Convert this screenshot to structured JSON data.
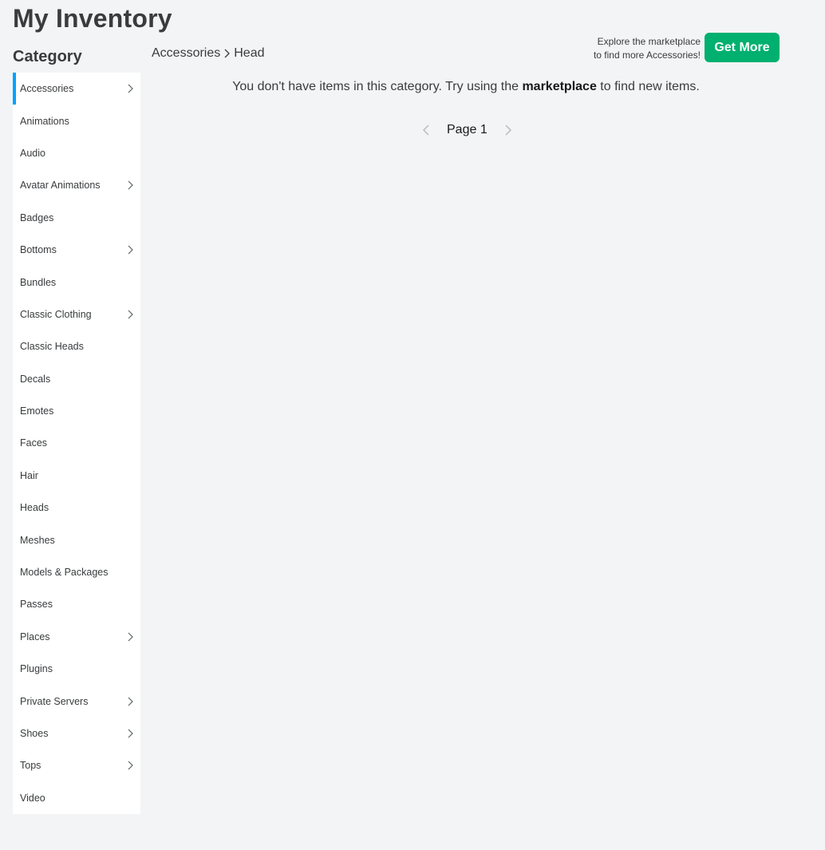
{
  "header": {
    "title": "My Inventory"
  },
  "sidebar": {
    "heading": "Category",
    "items": [
      {
        "label": "Accessories",
        "has_submenu": true,
        "active": true
      },
      {
        "label": "Animations",
        "has_submenu": false
      },
      {
        "label": "Audio",
        "has_submenu": false
      },
      {
        "label": "Avatar Animations",
        "has_submenu": true
      },
      {
        "label": "Badges",
        "has_submenu": false
      },
      {
        "label": "Bottoms",
        "has_submenu": true
      },
      {
        "label": "Bundles",
        "has_submenu": false
      },
      {
        "label": "Classic Clothing",
        "has_submenu": true
      },
      {
        "label": "Classic Heads",
        "has_submenu": false
      },
      {
        "label": "Decals",
        "has_submenu": false
      },
      {
        "label": "Emotes",
        "has_submenu": false
      },
      {
        "label": "Faces",
        "has_submenu": false
      },
      {
        "label": "Hair",
        "has_submenu": false
      },
      {
        "label": "Heads",
        "has_submenu": false
      },
      {
        "label": "Meshes",
        "has_submenu": false
      },
      {
        "label": "Models & Packages",
        "has_submenu": false
      },
      {
        "label": "Passes",
        "has_submenu": false
      },
      {
        "label": "Places",
        "has_submenu": true
      },
      {
        "label": "Plugins",
        "has_submenu": false
      },
      {
        "label": "Private Servers",
        "has_submenu": true
      },
      {
        "label": "Shoes",
        "has_submenu": true
      },
      {
        "label": "Tops",
        "has_submenu": true
      },
      {
        "label": "Video",
        "has_submenu": false
      }
    ]
  },
  "breadcrumb": {
    "parent": "Accessories",
    "current": "Head"
  },
  "promo": {
    "line1": "Explore the marketplace",
    "line2": "to find more Accessories!",
    "button_label": "Get More"
  },
  "empty_state": {
    "before": "You don't have items in this category. Try using the ",
    "link": "marketplace",
    "after": " to find new items."
  },
  "pagination": {
    "label": "Page 1"
  },
  "colors": {
    "active_indicator": "#00a2ff",
    "get_more_button": "#00b06f",
    "background": "#f2f4f5"
  }
}
